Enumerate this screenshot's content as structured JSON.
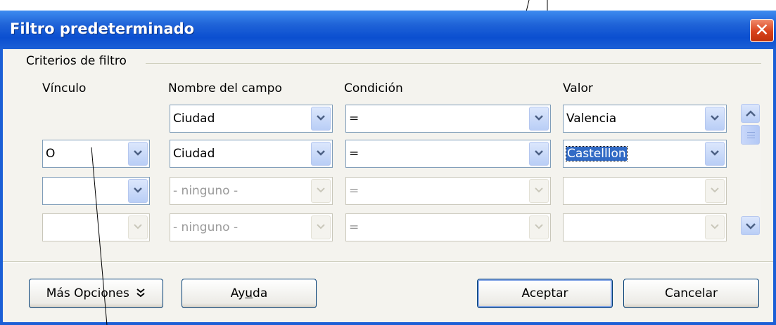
{
  "dialog": {
    "title": "Filtro predeterminado",
    "close_label": "✕"
  },
  "criteria": {
    "group_label": "Criterios de filtro",
    "headers": {
      "link": "Vínculo",
      "field": "Nombre del campo",
      "condition": "Condición",
      "value": "Valor"
    },
    "rows": [
      {
        "link": "",
        "field": "Ciudad",
        "condition": "=",
        "value": "Valencia",
        "enabled": true
      },
      {
        "link": "O",
        "field": "Ciudad",
        "condition": "=",
        "value": "Castelllon",
        "enabled": true
      },
      {
        "link": "",
        "field": "- ninguno -",
        "condition": "=",
        "value": "",
        "enabled": false
      },
      {
        "link": "",
        "field": "- ninguno -",
        "condition": "=",
        "value": "",
        "enabled": false
      }
    ]
  },
  "buttons": {
    "more_options": "Más Opciones",
    "help_pre": "Ay",
    "help_mnemonic": "u",
    "help_post": "da",
    "ok": "Aceptar",
    "cancel": "Cancelar"
  },
  "colors": {
    "title_bar": "#0b4fd0",
    "close": "#d8421c",
    "selection": "#316ac5"
  }
}
